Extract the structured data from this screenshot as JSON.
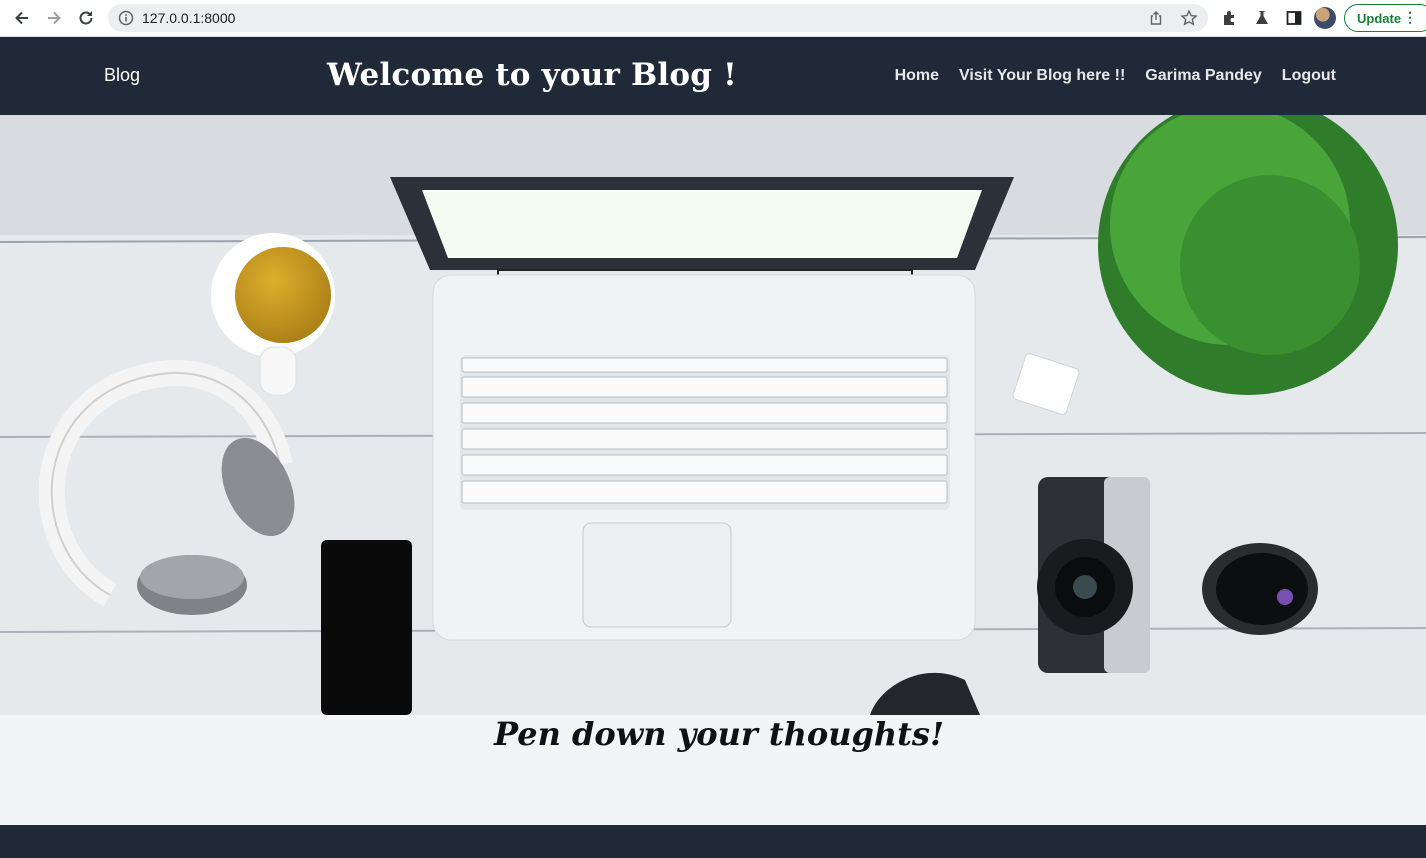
{
  "browser": {
    "url": "127.0.0.1:8000",
    "update_label": "Update",
    "back_icon": "back-arrow-icon",
    "forward_icon": "forward-arrow-icon",
    "reload_icon": "reload-icon"
  },
  "header": {
    "brand": "Blog",
    "title": "Welcome to your Blog !",
    "links": [
      "Home",
      "Visit Your Blog here !!",
      "Garima Pandey",
      "Logout"
    ]
  },
  "hero": {
    "image_subject": "desk-with-laptop-headphones-tea-phone-camera-plant"
  },
  "content": {
    "tagline": "Pen down your thoughts!"
  },
  "colors": {
    "header_bg": "#1f2937",
    "page_bg": "#f3f4f6",
    "update_green": "#188038"
  }
}
